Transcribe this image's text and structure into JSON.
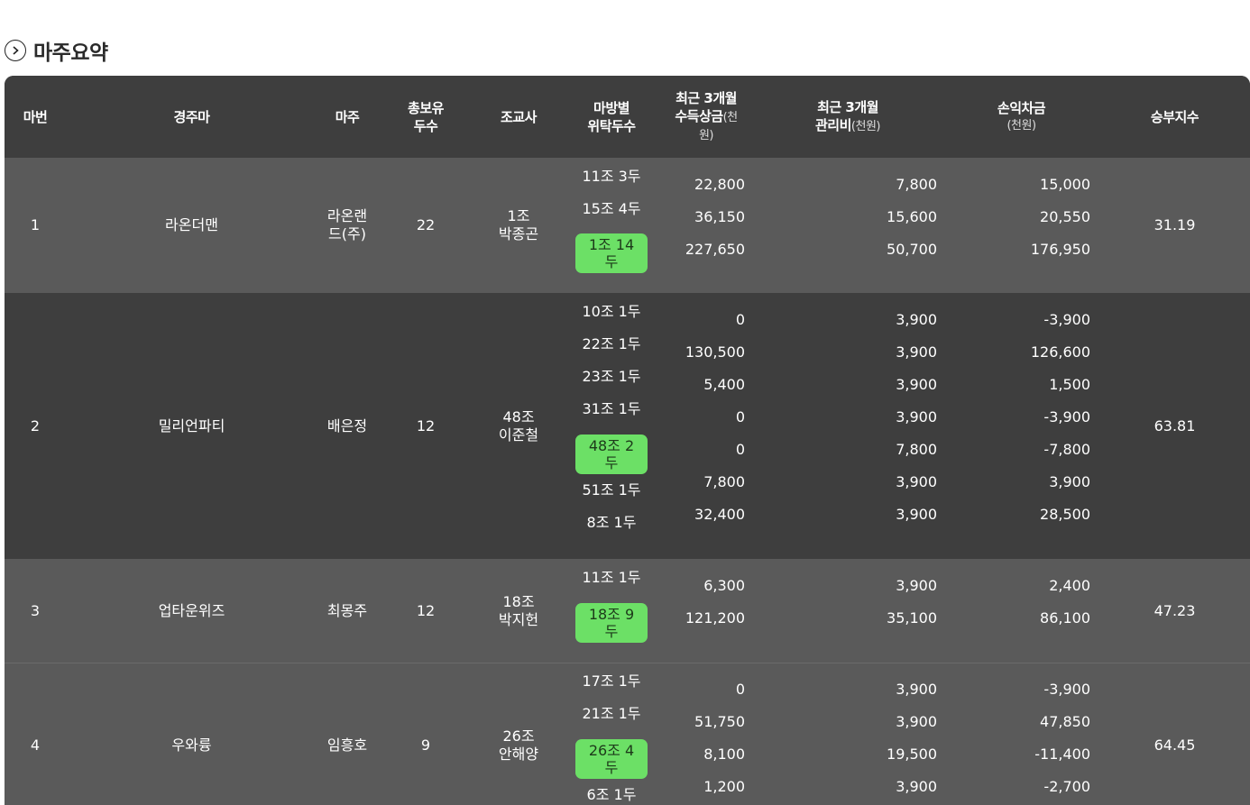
{
  "section": {
    "title": "마주요약",
    "icon": "chevron-right-circle-icon"
  },
  "colors": {
    "header_bg": "#3e3e3e",
    "row_light": "#5a5a5a",
    "row_dark": "#3e3e3e",
    "highlight": "#6ce066"
  },
  "header": {
    "col_no": "마번",
    "col_horse": "경주마",
    "col_owner": "마주",
    "col_total_1": "총보유",
    "col_total_2": "두수",
    "col_trainer": "조교사",
    "col_stable_1": "마방별",
    "col_stable_2": "위탁두수",
    "col_prize_1": "최근 3개월",
    "col_prize_2": "수득상금",
    "col_prize_unit_a": "(천",
    "col_prize_unit_b": "원)",
    "col_mgmt_1": "최근 3개월",
    "col_mgmt_2": "관리비",
    "col_mgmt_unit": "(천원)",
    "col_profit_1": "손익차금",
    "col_profit_unit": "(천원)",
    "col_win": "승부지수"
  },
  "rows": [
    {
      "no": "1",
      "horse": "라온더맨",
      "owner_1": "라온랜",
      "owner_2": "드(주)",
      "total": "22",
      "trainer_1": "1조",
      "trainer_2": "박종곤",
      "stables": [
        {
          "label": "11조 3두"
        },
        {
          "label": "15조 4두"
        },
        {
          "label_1": "1조 14",
          "label_2": "두"
        }
      ],
      "prize": [
        "22,800",
        "36,150",
        "227,650"
      ],
      "mgmt": [
        "7,800",
        "15,600",
        "50,700"
      ],
      "profit": [
        "15,000",
        "20,550",
        "176,950"
      ],
      "win": "31.19"
    },
    {
      "no": "2",
      "horse": "밀리언파티",
      "owner_1": "배은정",
      "total": "12",
      "trainer_1": "48조",
      "trainer_2": "이준철",
      "stables": [
        {
          "label": "10조 1두"
        },
        {
          "label": "22조 1두"
        },
        {
          "label": "23조 1두"
        },
        {
          "label": "31조 1두"
        },
        {
          "label_1": "48조 2",
          "label_2": "두"
        },
        {
          "label": "51조 1두"
        },
        {
          "label": "8조 1두"
        }
      ],
      "prize": [
        "0",
        "130,500",
        "5,400",
        "0",
        "0",
        "7,800",
        "32,400"
      ],
      "mgmt": [
        "3,900",
        "3,900",
        "3,900",
        "3,900",
        "7,800",
        "3,900",
        "3,900"
      ],
      "profit": [
        "-3,900",
        "126,600",
        "1,500",
        "-3,900",
        "-7,800",
        "3,900",
        "28,500"
      ],
      "win": "63.81"
    },
    {
      "no": "3",
      "horse": "업타운위즈",
      "owner_1": "최몽주",
      "total": "12",
      "trainer_1": "18조",
      "trainer_2": "박지헌",
      "stables": [
        {
          "label": "11조 1두"
        },
        {
          "label_1": "18조 9",
          "label_2": "두"
        }
      ],
      "prize": [
        "6,300",
        "121,200"
      ],
      "mgmt": [
        "3,900",
        "35,100"
      ],
      "profit": [
        "2,400",
        "86,100"
      ],
      "win": "47.23"
    },
    {
      "no": "4",
      "horse": "우와륭",
      "owner_1": "임흥호",
      "total": "9",
      "trainer_1": "26조",
      "trainer_2": "안해양",
      "stables": [
        {
          "label": "17조 1두"
        },
        {
          "label": "21조 1두"
        },
        {
          "label_1": "26조 4",
          "label_2": "두"
        },
        {
          "label": "6조 1두"
        }
      ],
      "prize": [
        "0",
        "51,750",
        "8,100",
        "1,200"
      ],
      "mgmt": [
        "3,900",
        "3,900",
        "19,500",
        "3,900"
      ],
      "profit": [
        "-3,900",
        "47,850",
        "-11,400",
        "-2,700"
      ],
      "win": "64.45"
    }
  ]
}
